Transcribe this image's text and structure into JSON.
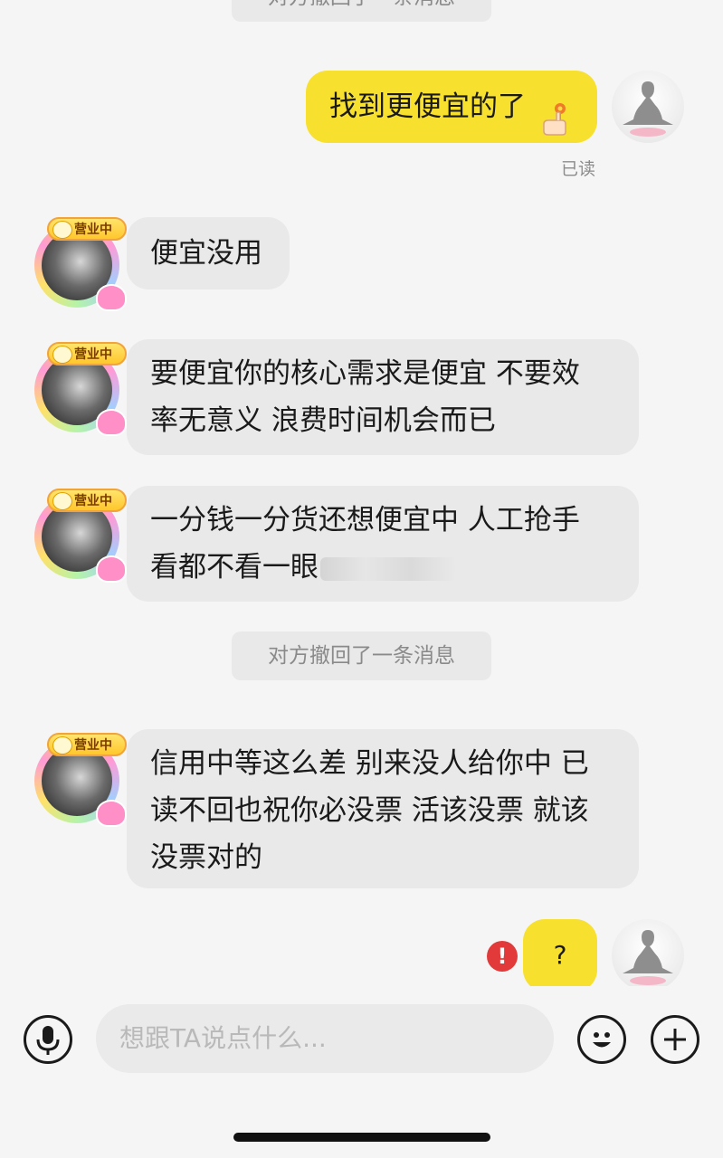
{
  "chat": {
    "recall_notice_top": "对方撤回了一条消息",
    "msg1": "找到更便宜的了",
    "read_status": "已读",
    "msg2": "便宜没用",
    "msg3_line1": "要便宜你的核心需求是便宜 不要效",
    "msg3_line2": "率无意义 浪费时间机会而已",
    "msg4_line1": "一分钱一分货还想便宜中 人工抢手",
    "msg4_line2": "看都不看一眼",
    "recall_notice": "对方撤回了一条消息",
    "msg5_line1": "信用中等这么差 别来没人给你中 已",
    "msg5_line2": "读不回也祝你必没票 活该没票 就该",
    "msg5_line3": "没票对的",
    "msg6": "?",
    "other_badge": "营业中",
    "error_mark": "!"
  },
  "composer": {
    "placeholder": "想跟TA说点什么..."
  },
  "colors": {
    "self_bubble": "#f7e02e",
    "other_bubble": "#e9e9e9",
    "error": "#e23a3a"
  },
  "icons": [
    "microphone-icon",
    "emoji-icon",
    "plus-icon",
    "error-icon",
    "thumb-flower-icon"
  ]
}
